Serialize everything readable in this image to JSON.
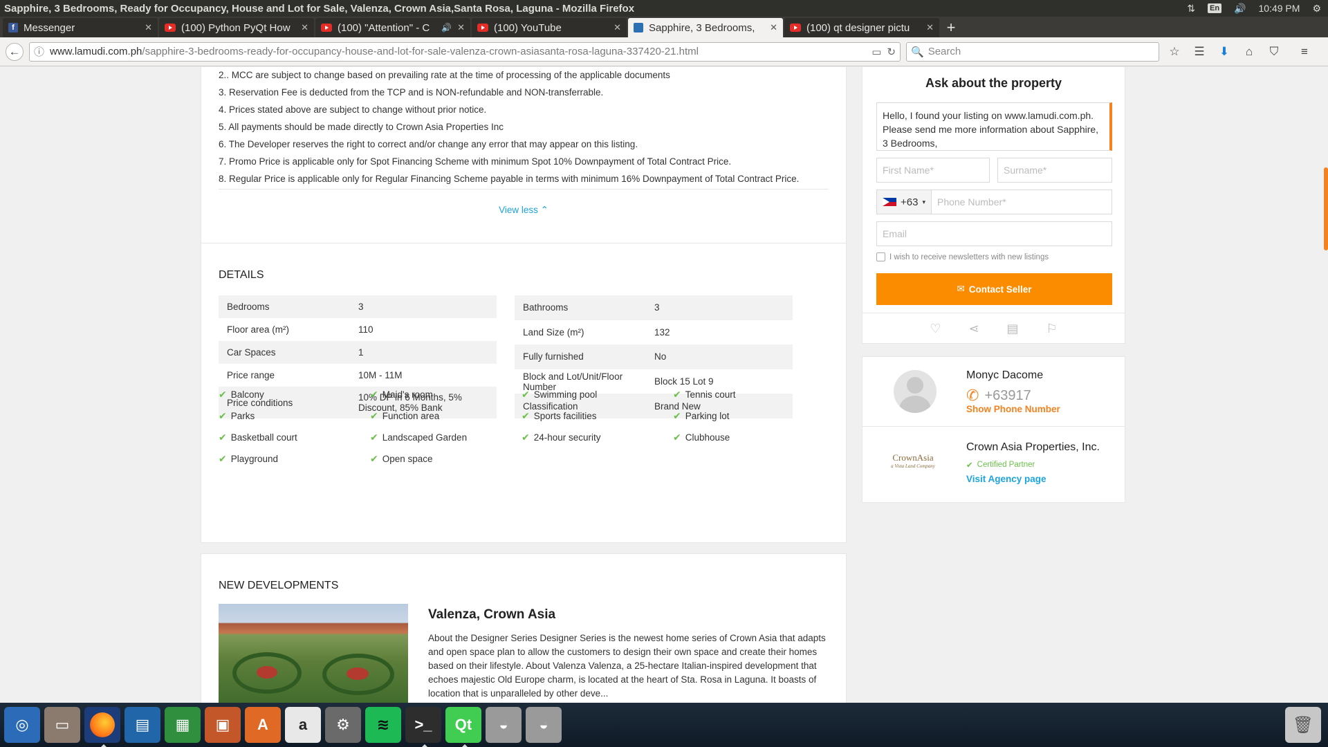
{
  "window": {
    "title": "Sapphire, 3 Bedrooms, Ready for Occupancy, House and Lot for Sale, Valenza, Crown Asia,Santa Rosa, Laguna - Mozilla Firefox",
    "keyboard_layout": "En",
    "clock": "10:49 PM"
  },
  "tabs": [
    {
      "label": "Messenger",
      "icon": "facebook-icon"
    },
    {
      "label": "(100) Python PyQt How",
      "icon": "youtube-icon"
    },
    {
      "label": "(100) \"Attention\" - C",
      "icon": "youtube-icon"
    },
    {
      "label": "(100) YouTube",
      "icon": "youtube-icon"
    },
    {
      "label": "Sapphire, 3 Bedrooms,",
      "icon": "lamudi-icon",
      "active": true
    },
    {
      "label": "(100) qt designer pictu",
      "icon": "youtube-icon"
    }
  ],
  "nav": {
    "url_domain": "www.lamudi.com.ph",
    "url_path": "/sapphire-3-bedrooms-ready-for-occupancy-house-and-lot-for-sale-valenza-crown-asiasanta-rosa-laguna-337420-21.html",
    "search_placeholder": "Search"
  },
  "notes": {
    "items": [
      "2.. MCC are subject to change based on prevailing rate at the time of processing of the applicable documents",
      "3. Reservation Fee is deducted from the TCP and is NON-refundable and NON-transferrable.",
      "4. Prices stated above are subject to change without prior notice.",
      "5. All payments should be made directly to Crown Asia Properties Inc",
      "6. The Developer reserves the right to correct and/or change any error that may appear on this listing.",
      "7. Promo Price is applicable only for Spot Financing Scheme with minimum Spot 10% Downpayment of Total Contract Price.",
      "8. Regular Price is applicable only for Regular Financing Scheme payable in terms with minimum 16% Downpayment of Total Contract Price."
    ],
    "view_less": "View less"
  },
  "details": {
    "heading": "DETAILS",
    "left": [
      {
        "key": "Bedrooms",
        "value": "3"
      },
      {
        "key": "Floor area (m²)",
        "value": "110"
      },
      {
        "key": "Car Spaces",
        "value": "1"
      },
      {
        "key": "Price range",
        "value": "10M - 11M"
      },
      {
        "key": "Price conditions",
        "value": "10% DP in 6 Months, 5% Discount, 85% Bank"
      }
    ],
    "right": [
      {
        "key": "Bathrooms",
        "value": "3"
      },
      {
        "key": "Land Size (m²)",
        "value": "132"
      },
      {
        "key": "Fully furnished",
        "value": "No"
      },
      {
        "key": "Block and Lot/Unit/Floor Number",
        "value": "Block 15 Lot 9"
      },
      {
        "key": "Classification",
        "value": "Brand New"
      }
    ],
    "amenities": [
      "Balcony",
      "Maid's room",
      "Swimming pool",
      "Tennis court",
      "Parks",
      "Function area",
      "Sports facilities",
      "Parking lot",
      "Basketball court",
      "Landscaped Garden",
      "24-hour security",
      "Clubhouse",
      "Playground",
      "Open space"
    ]
  },
  "new_developments": {
    "heading": "NEW DEVELOPMENTS",
    "title": "Valenza, Crown Asia",
    "description": "About the Designer Series Designer Series is the newest home series of Crown Asia that adapts and open space plan to allow the customers to design their own space and create their homes based on their lifestyle. About Valenza Valenza, a 25-hectare Italian-inspired development that echoes majestic Old Europe charm, is located at the heart of Sta. Rosa in Laguna. It boasts of location that is unparalleled by other deve..."
  },
  "inquiry": {
    "title": "Ask about the property",
    "message": "Hello, I found your listing on www.lamudi.com.ph. Please send me more information about Sapphire, 3 Bedrooms,",
    "first_name_placeholder": "First Name*",
    "surname_placeholder": "Surname*",
    "country_code": "+63",
    "phone_placeholder": "Phone Number*",
    "email_placeholder": "Email",
    "newsletter_label": "I wish to receive newsletters with new listings",
    "contact_button": "Contact Seller"
  },
  "agent": {
    "name": "Monyc Dacome",
    "phone_partial": "+63917",
    "show_phone": "Show Phone Number",
    "agency_name": "Crown Asia Properties, Inc.",
    "agency_logo_text": "CrownAsia",
    "agency_logo_tagline": "a Vista Land Company",
    "certified": "Certified Partner",
    "agency_link": "Visit Agency page"
  },
  "launcher": [
    {
      "name": "ubuntu-dash-icon"
    },
    {
      "name": "files-icon"
    },
    {
      "name": "firefox-icon"
    },
    {
      "name": "writer-icon"
    },
    {
      "name": "calc-icon"
    },
    {
      "name": "impress-icon"
    },
    {
      "name": "software-center-icon"
    },
    {
      "name": "amazon-icon"
    },
    {
      "name": "settings-icon"
    },
    {
      "name": "spotify-icon"
    },
    {
      "name": "terminal-icon"
    },
    {
      "name": "qt-creator-icon"
    },
    {
      "name": "drive-icon"
    },
    {
      "name": "drive2-icon"
    },
    {
      "name": "trash-icon"
    }
  ],
  "colors": {
    "accent": "#fb8c00",
    "link": "#1ba4e0",
    "check": "#6cc04a"
  }
}
